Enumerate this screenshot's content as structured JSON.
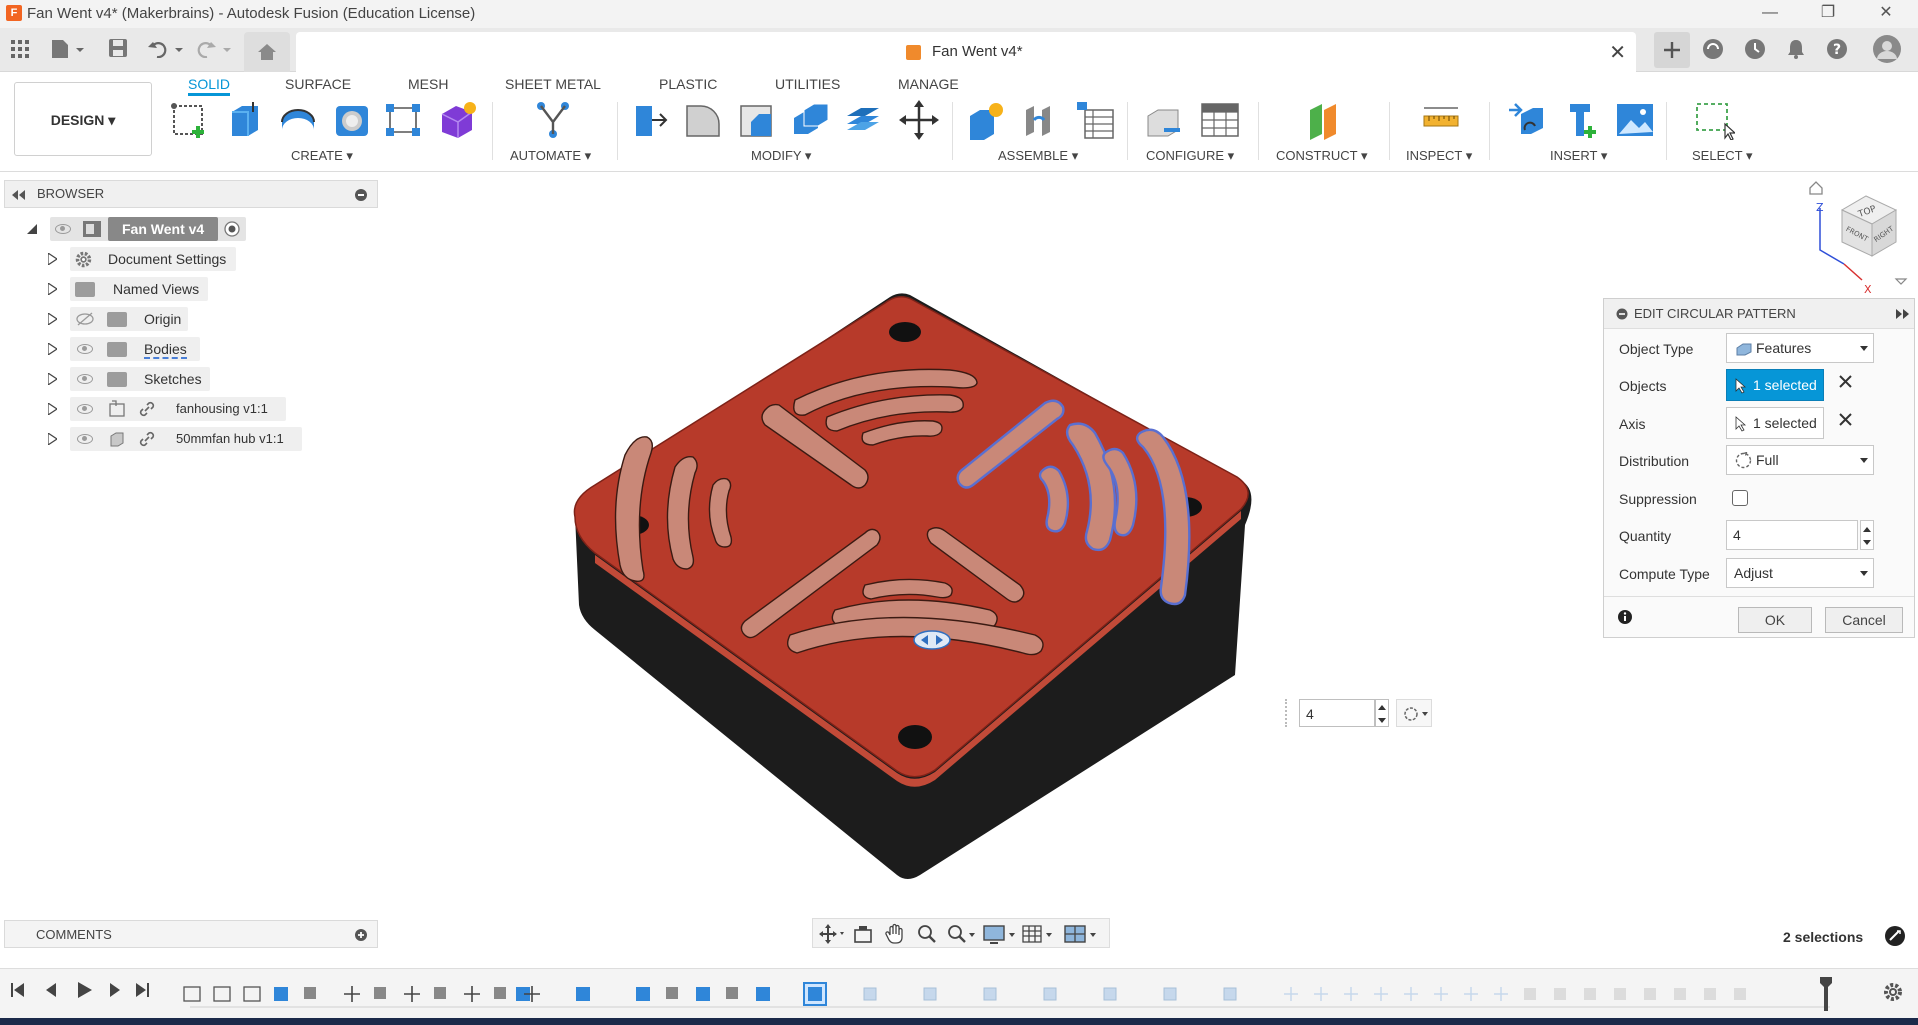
{
  "window": {
    "title": "Fan Went v4* (Makerbrains) - Autodesk Fusion (Education License)",
    "logo_letter": "F",
    "minimize": "—",
    "maximize": "❐",
    "close": "✕"
  },
  "document_tab": {
    "title": "Fan Went v4*",
    "close": "✕"
  },
  "ribbon": {
    "workspace": "DESIGN ▾",
    "tabs": [
      "SOLID",
      "SURFACE",
      "MESH",
      "SHEET METAL",
      "PLASTIC",
      "UTILITIES",
      "MANAGE"
    ],
    "active_tab": "SOLID",
    "groups": [
      "CREATE ▾",
      "AUTOMATE ▾",
      "MODIFY ▾",
      "ASSEMBLE ▾",
      "CONFIGURE ▾",
      "CONSTRUCT ▾",
      "INSPECT ▾",
      "INSERT ▾",
      "SELECT ▾"
    ]
  },
  "browser": {
    "title": "BROWSER",
    "items": [
      {
        "label": "Fan Went v4"
      },
      {
        "label": "Document Settings"
      },
      {
        "label": "Named Views"
      },
      {
        "label": "Origin"
      },
      {
        "label": "Bodies"
      },
      {
        "label": "Sketches"
      },
      {
        "label": "fanhousing v1:1"
      },
      {
        "label": "50mmfan hub v1:1"
      }
    ]
  },
  "edit_panel": {
    "title": "EDIT CIRCULAR PATTERN",
    "object_type_label": "Object Type",
    "object_type_value": "Features",
    "objects_label": "Objects",
    "objects_value": "1 selected",
    "axis_label": "Axis",
    "axis_value": "1 selected",
    "distribution_label": "Distribution",
    "distribution_value": "Full",
    "suppression_label": "Suppression",
    "quantity_label": "Quantity",
    "quantity_value": "4",
    "compute_type_label": "Compute Type",
    "compute_type_value": "Adjust",
    "ok": "OK",
    "cancel": "Cancel"
  },
  "viewcube": {
    "top": "TOP",
    "front": "FRONT",
    "right": "RIGHT",
    "axis_z": "Z",
    "axis_x": "X"
  },
  "inline_quantity": "4",
  "comments": {
    "title": "COMMENTS"
  },
  "status": {
    "selections": "2 selections"
  },
  "colors": {
    "accent": "#0696d7",
    "model_top": "#b73a2a",
    "model_side": "#1c1c1c",
    "selection_blue": "#6c7fd6"
  }
}
